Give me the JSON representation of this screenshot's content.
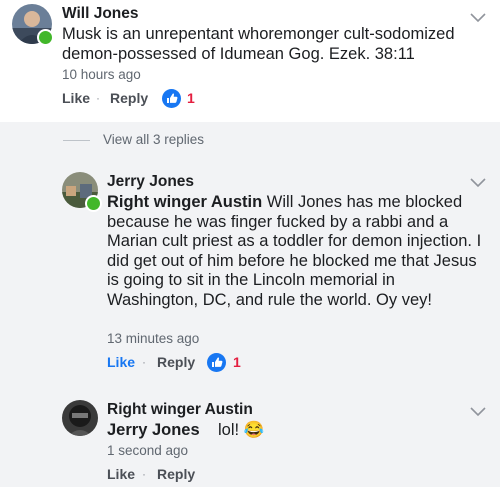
{
  "comments": [
    {
      "author": "Will Jones",
      "text": "Musk is an unrepentant whoremonger cult-sodomized demon-possessed of Idumean Gog. Ezek. 38:11",
      "time": "10 hours ago",
      "like_label": "Like",
      "reply_label": "Reply",
      "reaction_count": "1"
    }
  ],
  "replies_link": "View all 3 replies",
  "replies": [
    {
      "author": "Jerry Jones",
      "mention": "Right winger Austin",
      "text": " Will Jones has me blocked because he was finger fucked by a rabbi and a Marian cult priest as a toddler for demon injection.  I did get out of him before he blocked me that Jesus is going to sit in the Lincoln memorial in Washington, DC, and rule the world. Oy vey!",
      "time": "13 minutes ago",
      "like_label": "Like",
      "reply_label": "Reply",
      "reaction_count": "1"
    },
    {
      "author": "Right winger Austin",
      "mention": "Jerry Jones",
      "text": "lol!",
      "emoji": "😂",
      "time": "1 second ago",
      "like_label": "Like",
      "reply_label": "Reply"
    }
  ],
  "colors": {
    "link_blue": "#1877f2",
    "reaction_red": "#e41e3f",
    "online_green": "#42b72a",
    "meta_gray": "#606770"
  },
  "icons": [
    "chevron-down-icon",
    "thumbs-up-icon",
    "online-status-icon"
  ]
}
